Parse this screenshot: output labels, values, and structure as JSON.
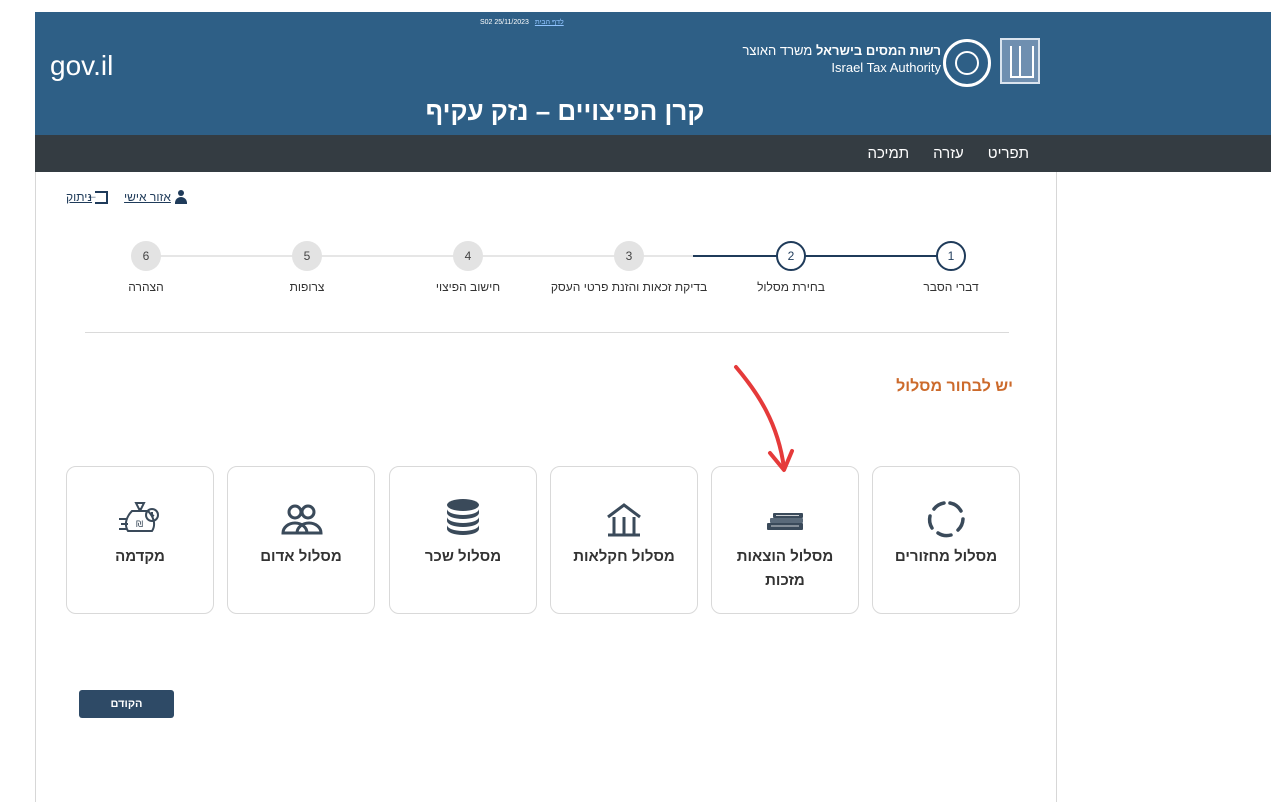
{
  "header": {
    "meta_text": "S02 25/11/2023",
    "meta_link": "לדף הבית",
    "gov_logo": "gov.il",
    "authority_he_bold": "רשות המסים בישראל",
    "authority_he_rest": "משרד האוצר",
    "authority_en": "Israel Tax Authority",
    "page_title": "קרן הפיצויים – נזק עקיף"
  },
  "nav": {
    "items": [
      {
        "label": "תפריט"
      },
      {
        "label": "עזרה"
      },
      {
        "label": "תמיכה"
      }
    ]
  },
  "user": {
    "personal_area": "אזור אישי",
    "logout": "ניתוק"
  },
  "steps": [
    {
      "number": "1",
      "label": "דברי הסבר",
      "active": true
    },
    {
      "number": "2",
      "label": "בחירת מסלול",
      "active": true
    },
    {
      "number": "3",
      "label": "בדיקת זכאות והזנת פרטי העסק",
      "active": false
    },
    {
      "number": "4",
      "label": "חישוב הפיצוי",
      "active": false
    },
    {
      "number": "5",
      "label": "צרופות",
      "active": false
    },
    {
      "number": "6",
      "label": "הצהרה",
      "active": false
    }
  ],
  "choose_title": "יש לבחור מסלול",
  "cards": [
    {
      "label": "מסלול מחזורים",
      "icon": "circular-arrows-icon"
    },
    {
      "label": "מסלול הוצאות מזכות",
      "icon": "banknotes-icon"
    },
    {
      "label": "מסלול חקלאות",
      "icon": "house-icon"
    },
    {
      "label": "מסלול שכר",
      "icon": "coins-icon"
    },
    {
      "label": "מסלול אדום",
      "icon": "people-icon"
    },
    {
      "label": "מקדמה",
      "icon": "money-bag-icon"
    }
  ],
  "buttons": {
    "previous": "הקודם"
  },
  "colors": {
    "header_bg": "#2e5f86",
    "nav_bg": "#343c42",
    "accent": "#1f3b5a",
    "title_orange": "#cc6a2b",
    "annotation_red": "#e53a3a"
  }
}
